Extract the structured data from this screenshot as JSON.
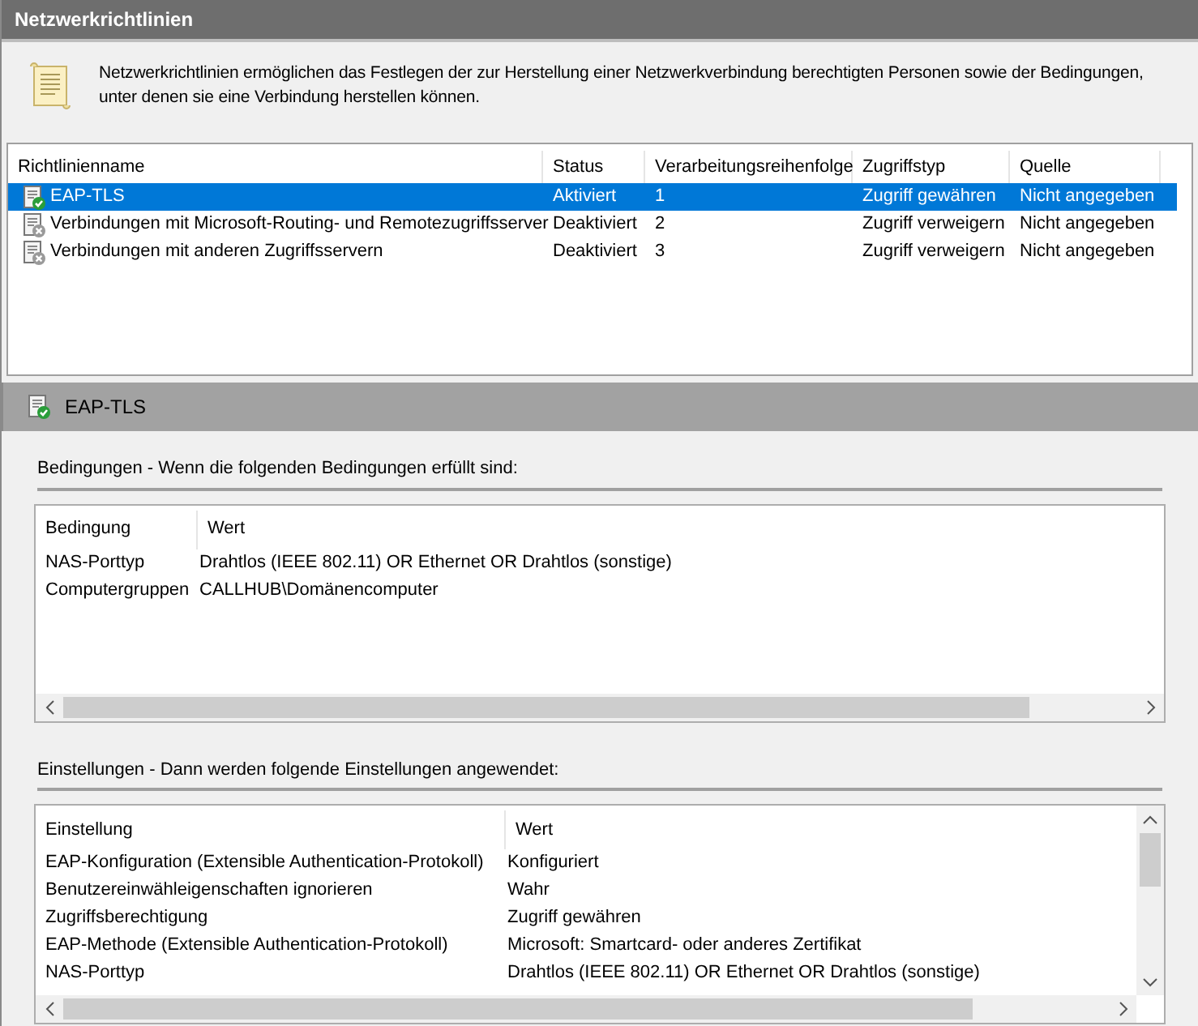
{
  "window": {
    "title": "Netzwerkrichtlinien"
  },
  "description": "Netzwerkrichtlinien ermöglichen das Festlegen der zur Herstellung einer Netzwerkverbindung berechtigten Personen sowie der Bedingungen, unter denen sie eine Verbindung herstellen können.",
  "policies": {
    "columns": [
      "Richtlinienname",
      "Status",
      "Verarbeitungsreihenfolge",
      "Zugriffstyp",
      "Quelle"
    ],
    "rows": [
      {
        "cells": [
          "EAP-TLS",
          "Aktiviert",
          "1",
          "Zugriff gewähren",
          "Nicht angegeben"
        ],
        "selected": true,
        "enabled": true
      },
      {
        "cells": [
          "Verbindungen mit Microsoft-Routing- und Remotezugriffsserver",
          "Deaktiviert",
          "2",
          "Zugriff verweigern",
          "Nicht angegeben"
        ],
        "selected": false,
        "enabled": false
      },
      {
        "cells": [
          "Verbindungen mit anderen Zugriffsservern",
          "Deaktiviert",
          "3",
          "Zugriff verweigern",
          "Nicht angegeben"
        ],
        "selected": false,
        "enabled": false
      }
    ]
  },
  "details": {
    "title": "EAP-TLS",
    "conditions": {
      "heading": "Bedingungen - Wenn die folgenden Bedingungen erfüllt sind:",
      "columns": [
        "Bedingung",
        "Wert"
      ],
      "rows": [
        [
          "NAS-Porttyp",
          "Drahtlos (IEEE 802.11) OR Ethernet OR Drahtlos (sonstige)"
        ],
        [
          "Computergruppen",
          "CALLHUB\\Domänencomputer"
        ]
      ]
    },
    "settings": {
      "heading": "Einstellungen - Dann werden folgende Einstellungen angewendet:",
      "columns": [
        "Einstellung",
        "Wert"
      ],
      "rows": [
        [
          "EAP-Konfiguration (Extensible Authentication-Protokoll)",
          "Konfiguriert"
        ],
        [
          "Benutzereinwähleigenschaften ignorieren",
          "Wahr"
        ],
        [
          "Zugriffsberechtigung",
          "Zugriff gewähren"
        ],
        [
          "EAP-Methode (Extensible Authentication-Protokoll)",
          "Microsoft: Smartcard- oder anderes Zertifikat"
        ],
        [
          "NAS-Porttyp",
          "Drahtlos (IEEE 802.11) OR Ethernet OR Drahtlos (sonstige)"
        ]
      ]
    }
  }
}
